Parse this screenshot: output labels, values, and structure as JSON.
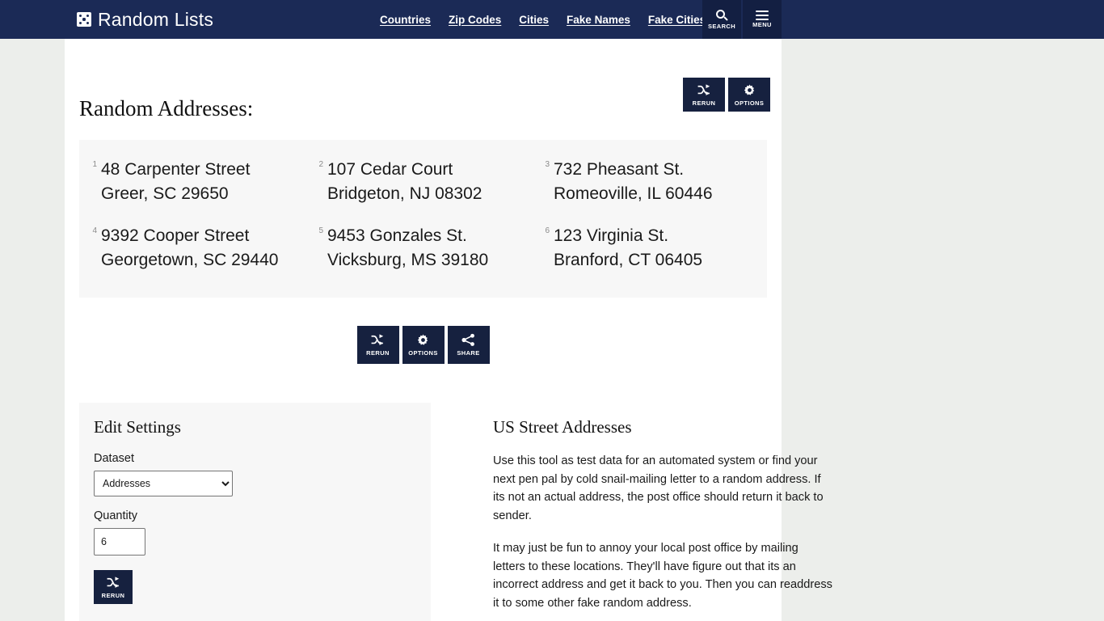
{
  "header": {
    "brand": "Random Lists",
    "brand_icon": "dice-icon",
    "nav": [
      {
        "label": "Countries"
      },
      {
        "label": "Zip Codes"
      },
      {
        "label": "Cities"
      },
      {
        "label": "Fake Names"
      },
      {
        "label": "Fake Cities"
      }
    ],
    "search_label": "SEARCH",
    "search_icon": "search-icon",
    "menu_label": "MENU",
    "menu_icon": "hamburger-menu-icon"
  },
  "main": {
    "title": "Random Addresses:",
    "top_actions": [
      {
        "label": "RERUN",
        "icon": "shuffle-icon"
      },
      {
        "label": "OPTIONS",
        "icon": "gear-icon"
      }
    ],
    "results": [
      {
        "index": "1",
        "line1": "48 Carpenter Street",
        "line2": "Greer, SC 29650"
      },
      {
        "index": "2",
        "line1": "107 Cedar Court",
        "line2": "Bridgeton, NJ 08302"
      },
      {
        "index": "3",
        "line1": "732 Pheasant St.",
        "line2": "Romeoville, IL 60446"
      },
      {
        "index": "4",
        "line1": "9392 Cooper Street",
        "line2": "Georgetown, SC 29440"
      },
      {
        "index": "5",
        "line1": "9453 Gonzales St.",
        "line2": "Vicksburg, MS 39180"
      },
      {
        "index": "6",
        "line1": "123 Virginia St.",
        "line2": "Branford, CT 06405"
      }
    ],
    "mid_actions": [
      {
        "label": "RERUN",
        "icon": "shuffle-icon"
      },
      {
        "label": "OPTIONS",
        "icon": "gear-icon"
      },
      {
        "label": "SHARE",
        "icon": "share-icon"
      }
    ]
  },
  "settings": {
    "title": "Edit Settings",
    "dataset_label": "Dataset",
    "dataset_value": "Addresses",
    "dataset_options": [
      "Addresses"
    ],
    "quantity_label": "Quantity",
    "quantity_value": "6",
    "rerun_label": "RERUN",
    "rerun_icon": "shuffle-icon"
  },
  "about": {
    "heading": "US Street Addresses",
    "paragraph1": "Use this tool as test data for an automated system or find your next pen pal by cold snail-mailing letter to a random address. If its not an actual address, the post office should return it back to sender.",
    "paragraph2": "It may just be fun to annoy your local post office by mailing letters to these locations. They'll have figure out that its an incorrect address and get it back to you. Then you can readdress it to some other fake random address."
  },
  "colors": {
    "header_bg": "#1b2a56",
    "button_bg": "#16213f",
    "page_bg": "#eceeeb",
    "panel_bg": "#f7f7f7"
  }
}
